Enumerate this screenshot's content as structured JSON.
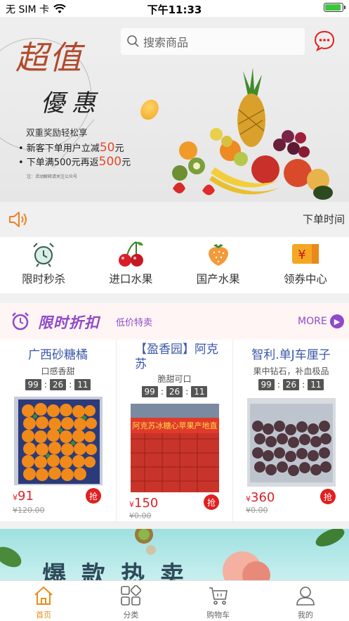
{
  "status_bar": {
    "carrier": "无 SIM 卡",
    "time": "下午11:33",
    "battery_level": 0.9
  },
  "banner": {
    "search_placeholder": "搜索商品",
    "headline_1": "超值",
    "headline_2": "優惠",
    "promo_title": "双重奖励轻松享",
    "promo_1_prefix": "• 新客下单用户立减",
    "promo_1_amount": "50",
    "promo_1_unit": "元",
    "promo_2_prefix": "• 下单满500元再返",
    "promo_2_amount": "500",
    "promo_2_unit": "元",
    "note": "注：活动解释请关注公众号"
  },
  "notice": {
    "text": "下单时间"
  },
  "categories": [
    {
      "label": "限时秒杀",
      "icon": "alarm-clock-icon"
    },
    {
      "label": "进口水果",
      "icon": "cherry-icon"
    },
    {
      "label": "国产水果",
      "icon": "strawberry-icon"
    },
    {
      "label": "领券中心",
      "icon": "coupon-icon"
    }
  ],
  "flash_sale": {
    "title": "限时折扣",
    "subtitle": "低价特卖",
    "more": "MORE",
    "products": [
      {
        "name": "广西砂糖橘",
        "desc": "口感香甜",
        "hh": "99",
        "mm": "26",
        "ss": "11",
        "yen": "¥",
        "price": "91",
        "old_price": "¥120.00",
        "buy": "抢"
      },
      {
        "name": "【盈香园】阿克苏",
        "desc": "脆甜可口",
        "hh": "99",
        "mm": "26",
        "ss": "11",
        "yen": "¥",
        "price": "150",
        "old_price": "¥0.00",
        "buy": "抢",
        "img_text": "阿克苏冰糖心苹果产地直"
      },
      {
        "name": "智利.单J车厘子",
        "desc": "果中钻石，补血极品",
        "hh": "99",
        "mm": "26",
        "ss": "11",
        "yen": "¥",
        "price": "360",
        "old_price": "¥0.00",
        "buy": "抢"
      }
    ]
  },
  "hot_banner": {
    "text": "爆款热卖"
  },
  "tabbar": [
    {
      "label": "首页",
      "icon": "home-icon",
      "active": true
    },
    {
      "label": "分类",
      "icon": "grid-icon",
      "active": false
    },
    {
      "label": "购物车",
      "icon": "cart-icon",
      "active": false
    },
    {
      "label": "我的",
      "icon": "profile-icon",
      "active": false
    }
  ],
  "colors": {
    "accent": "#e88e1a",
    "purple": "#8e4ac8",
    "price_red": "#e0202a",
    "name_blue": "#3a57a8"
  }
}
